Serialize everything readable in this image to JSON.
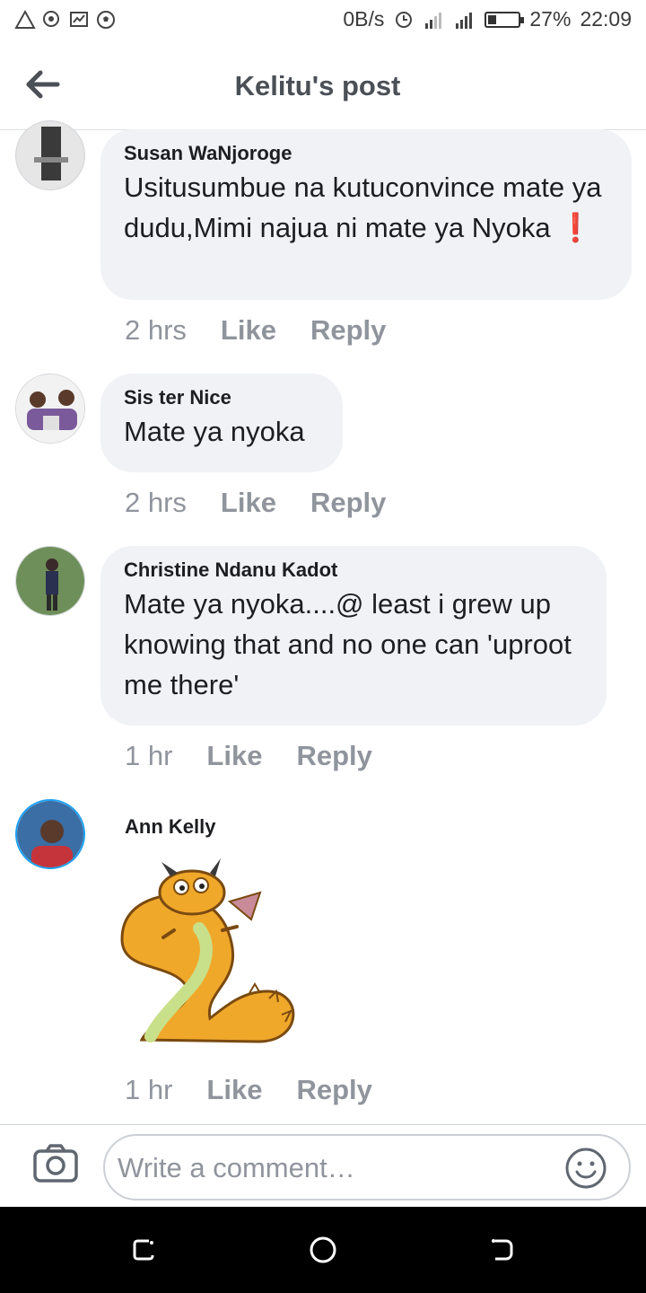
{
  "status_bar": {
    "net_speed": "0B/s",
    "battery_percent": "27%",
    "battery_level": 0.27,
    "time": "22:09"
  },
  "header": {
    "title": "Kelitu's post"
  },
  "comments": [
    {
      "author": "Susan WaNjoroge",
      "text": "Usitusumbue na kutuconvince mate ya dudu,Mimi najua ni mate ya Nyoka",
      "emoji": "❗",
      "time": "2 hrs",
      "like": "Like",
      "reply": "Reply"
    },
    {
      "author": "Sis ter Nice",
      "text": "Mate ya nyoka",
      "time": "2 hrs",
      "like": "Like",
      "reply": "Reply"
    },
    {
      "author": "Christine Ndanu Kadot",
      "text": "Mate ya nyoka....@ least i grew up knowing that and no one can 'uproot me there'",
      "time": "1 hr",
      "like": "Like",
      "reply": "Reply"
    },
    {
      "author": "Ann Kelly",
      "sticker": "dragon-sticker",
      "time": "1 hr",
      "like": "Like",
      "reply": "Reply"
    }
  ],
  "composer": {
    "placeholder": "Write a comment…"
  },
  "colors": {
    "bubble": "#f0f2f5",
    "muted": "#90949c",
    "dragon": "#f0a82a"
  }
}
